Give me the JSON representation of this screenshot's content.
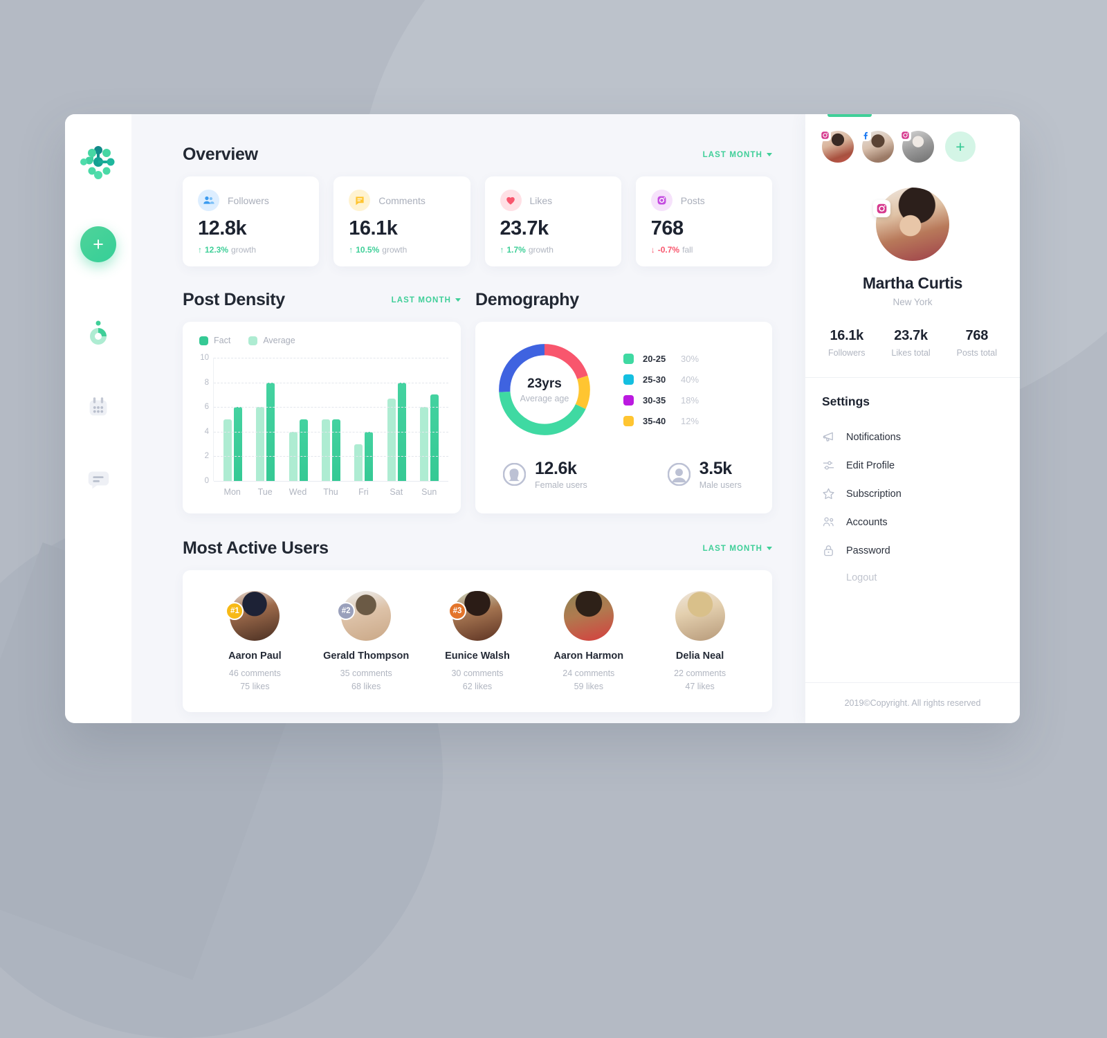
{
  "window": {
    "background_color": "#b4bac4",
    "surface_color": "#f5f6fa",
    "accent_color": "#3fcf98"
  },
  "rail": {
    "logo_name": "molecule-logo",
    "add_button_label": "+",
    "items": [
      {
        "name": "analytics",
        "icon": "donut-chart-icon",
        "active": true
      },
      {
        "name": "calendar",
        "icon": "calendar-icon",
        "active": false
      },
      {
        "name": "messages",
        "icon": "chat-icon",
        "active": false
      }
    ]
  },
  "overview": {
    "title": "Overview",
    "period_label": "LAST MONTH",
    "cards": [
      {
        "label": "Followers",
        "value": "12.8k",
        "delta": "12.3%",
        "delta_word": "growth",
        "direction": "up",
        "icon": "people-icon",
        "icon_color": "#3b9bf0",
        "icon_bg": "#ddeeff"
      },
      {
        "label": "Comments",
        "value": "16.1k",
        "delta": "10.5%",
        "delta_word": "growth",
        "direction": "up",
        "icon": "comment-icon",
        "icon_color": "#ffc531",
        "icon_bg": "#fff3d1"
      },
      {
        "label": "Likes",
        "value": "23.7k",
        "delta": "1.7%",
        "delta_word": "growth",
        "direction": "up",
        "icon": "heart-icon",
        "icon_color": "#f8566d",
        "icon_bg": "#ffe0e5"
      },
      {
        "label": "Posts",
        "value": "768",
        "delta": "-0.7%",
        "delta_word": "fall",
        "direction": "down",
        "icon": "instagram-icon",
        "icon_color": "#c44ce0",
        "icon_bg": "#f6e2fb"
      }
    ]
  },
  "post_density": {
    "title": "Post Density",
    "period_label": "LAST MONTH"
  },
  "demography": {
    "title": "Demography",
    "center_value": "23yrs",
    "center_label": "Average age",
    "female": {
      "value": "12.6k",
      "label": "Female users",
      "icon": "female-avatar-icon"
    },
    "male": {
      "value": "3.5k",
      "label": "Male users",
      "icon": "male-avatar-icon"
    }
  },
  "most_active_users": {
    "title": "Most Active Users",
    "period_label": "LAST MONTH",
    "users": [
      {
        "name": "Aaron Paul",
        "comments": "46 comments",
        "likes": "75 likes",
        "rank": "#1",
        "rank_color": "#f7b916"
      },
      {
        "name": "Gerald Thompson",
        "comments": "35 comments",
        "likes": "68 likes",
        "rank": "#2",
        "rank_color": "#9aa0bb"
      },
      {
        "name": "Eunice Walsh",
        "comments": "30 comments",
        "likes": "62 likes",
        "rank": "#3",
        "rank_color": "#e3742a"
      },
      {
        "name": "Aaron Harmon",
        "comments": "24 comments",
        "likes": "59 likes",
        "rank": "",
        "rank_color": ""
      },
      {
        "name": "Delia Neal",
        "comments": "22 comments",
        "likes": "47 likes",
        "rank": "",
        "rank_color": ""
      }
    ]
  },
  "profile": {
    "accounts": [
      {
        "badge": "instagram-icon"
      },
      {
        "badge": "facebook-icon"
      },
      {
        "badge": "instagram-icon"
      }
    ],
    "add_account_label": "+",
    "badge": "instagram-icon",
    "name": "Martha Curtis",
    "location": "New York",
    "stats": [
      {
        "value": "16.1k",
        "label": "Followers"
      },
      {
        "value": "23.7k",
        "label": "Likes total"
      },
      {
        "value": "768",
        "label": "Posts total"
      }
    ]
  },
  "settings": {
    "title": "Settings",
    "items": [
      {
        "label": "Notifications",
        "icon": "megaphone-icon"
      },
      {
        "label": "Edit Profile",
        "icon": "sliders-icon"
      },
      {
        "label": "Subscription",
        "icon": "star-icon"
      },
      {
        "label": "Accounts",
        "icon": "people-icon"
      },
      {
        "label": "Password",
        "icon": "lock-icon"
      }
    ],
    "logout_label": "Logout"
  },
  "footer": {
    "copyright": "2019©Copyright. All rights reserved"
  },
  "chart_data": [
    {
      "type": "bar",
      "title": "Post Density",
      "categories": [
        "Mon",
        "Tue",
        "Wed",
        "Thu",
        "Fri",
        "Sat",
        "Sun"
      ],
      "series": [
        {
          "name": "Average",
          "color": "#aeecd2",
          "values": [
            5,
            6,
            4,
            5,
            3,
            6.7,
            6
          ]
        },
        {
          "name": "Fact",
          "color": "#35c994",
          "values": [
            6,
            8,
            5,
            5,
            4,
            8,
            7
          ]
        }
      ],
      "legend": [
        "Fact",
        "Average"
      ],
      "ylabel": "",
      "xlabel": "",
      "ylim": [
        0,
        10
      ],
      "yticks": [
        0,
        2,
        4,
        6,
        8,
        10
      ],
      "grid": true,
      "legend_position": "top-left"
    },
    {
      "type": "pie",
      "title": "Demography",
      "subtitle": "23yrs Average age",
      "donut": true,
      "labels": [
        "20-25",
        "25-30",
        "30-35",
        "35-40"
      ],
      "values": [
        30,
        40,
        18,
        12
      ],
      "value_labels": [
        "30%",
        "40%",
        "18%",
        "12%"
      ],
      "legend_colors": [
        "#3fd9a2",
        "#14bfe0",
        "#bb1ae0",
        "#ffc531"
      ],
      "segments": [
        {
          "name": "segment-red",
          "color": "#f8566d",
          "share": 20
        },
        {
          "name": "segment-yellow",
          "color": "#ffc531",
          "share": 12
        },
        {
          "name": "segment-green",
          "color": "#3fd9a2",
          "share": 42
        },
        {
          "name": "segment-blue",
          "color": "#3f63e0",
          "share": 26
        }
      ],
      "legend_position": "right"
    }
  ]
}
